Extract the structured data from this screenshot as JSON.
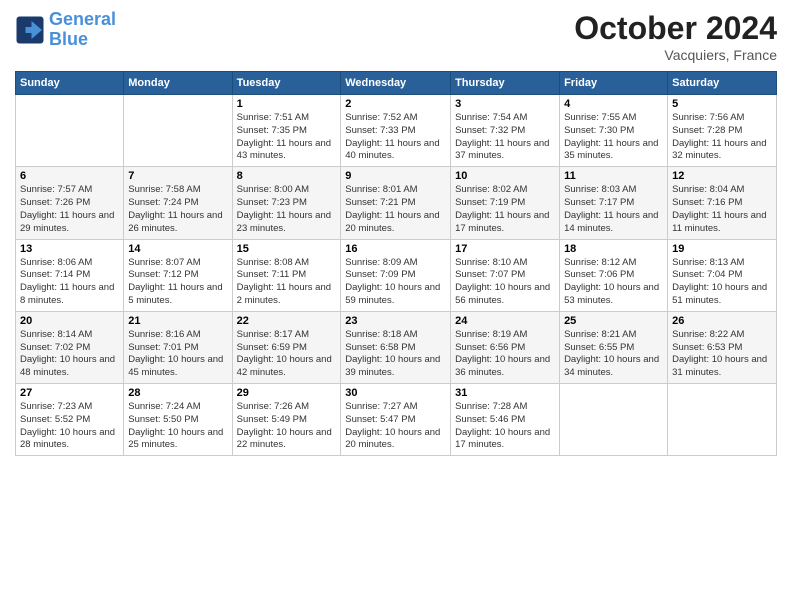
{
  "header": {
    "logo_line1": "General",
    "logo_line2": "Blue",
    "month": "October 2024",
    "location": "Vacquiers, France"
  },
  "weekdays": [
    "Sunday",
    "Monday",
    "Tuesday",
    "Wednesday",
    "Thursday",
    "Friday",
    "Saturday"
  ],
  "weeks": [
    [
      {
        "day": "",
        "info": ""
      },
      {
        "day": "",
        "info": ""
      },
      {
        "day": "1",
        "info": "Sunrise: 7:51 AM\nSunset: 7:35 PM\nDaylight: 11 hours and 43 minutes."
      },
      {
        "day": "2",
        "info": "Sunrise: 7:52 AM\nSunset: 7:33 PM\nDaylight: 11 hours and 40 minutes."
      },
      {
        "day": "3",
        "info": "Sunrise: 7:54 AM\nSunset: 7:32 PM\nDaylight: 11 hours and 37 minutes."
      },
      {
        "day": "4",
        "info": "Sunrise: 7:55 AM\nSunset: 7:30 PM\nDaylight: 11 hours and 35 minutes."
      },
      {
        "day": "5",
        "info": "Sunrise: 7:56 AM\nSunset: 7:28 PM\nDaylight: 11 hours and 32 minutes."
      }
    ],
    [
      {
        "day": "6",
        "info": "Sunrise: 7:57 AM\nSunset: 7:26 PM\nDaylight: 11 hours and 29 minutes."
      },
      {
        "day": "7",
        "info": "Sunrise: 7:58 AM\nSunset: 7:24 PM\nDaylight: 11 hours and 26 minutes."
      },
      {
        "day": "8",
        "info": "Sunrise: 8:00 AM\nSunset: 7:23 PM\nDaylight: 11 hours and 23 minutes."
      },
      {
        "day": "9",
        "info": "Sunrise: 8:01 AM\nSunset: 7:21 PM\nDaylight: 11 hours and 20 minutes."
      },
      {
        "day": "10",
        "info": "Sunrise: 8:02 AM\nSunset: 7:19 PM\nDaylight: 11 hours and 17 minutes."
      },
      {
        "day": "11",
        "info": "Sunrise: 8:03 AM\nSunset: 7:17 PM\nDaylight: 11 hours and 14 minutes."
      },
      {
        "day": "12",
        "info": "Sunrise: 8:04 AM\nSunset: 7:16 PM\nDaylight: 11 hours and 11 minutes."
      }
    ],
    [
      {
        "day": "13",
        "info": "Sunrise: 8:06 AM\nSunset: 7:14 PM\nDaylight: 11 hours and 8 minutes."
      },
      {
        "day": "14",
        "info": "Sunrise: 8:07 AM\nSunset: 7:12 PM\nDaylight: 11 hours and 5 minutes."
      },
      {
        "day": "15",
        "info": "Sunrise: 8:08 AM\nSunset: 7:11 PM\nDaylight: 11 hours and 2 minutes."
      },
      {
        "day": "16",
        "info": "Sunrise: 8:09 AM\nSunset: 7:09 PM\nDaylight: 10 hours and 59 minutes."
      },
      {
        "day": "17",
        "info": "Sunrise: 8:10 AM\nSunset: 7:07 PM\nDaylight: 10 hours and 56 minutes."
      },
      {
        "day": "18",
        "info": "Sunrise: 8:12 AM\nSunset: 7:06 PM\nDaylight: 10 hours and 53 minutes."
      },
      {
        "day": "19",
        "info": "Sunrise: 8:13 AM\nSunset: 7:04 PM\nDaylight: 10 hours and 51 minutes."
      }
    ],
    [
      {
        "day": "20",
        "info": "Sunrise: 8:14 AM\nSunset: 7:02 PM\nDaylight: 10 hours and 48 minutes."
      },
      {
        "day": "21",
        "info": "Sunrise: 8:16 AM\nSunset: 7:01 PM\nDaylight: 10 hours and 45 minutes."
      },
      {
        "day": "22",
        "info": "Sunrise: 8:17 AM\nSunset: 6:59 PM\nDaylight: 10 hours and 42 minutes."
      },
      {
        "day": "23",
        "info": "Sunrise: 8:18 AM\nSunset: 6:58 PM\nDaylight: 10 hours and 39 minutes."
      },
      {
        "day": "24",
        "info": "Sunrise: 8:19 AM\nSunset: 6:56 PM\nDaylight: 10 hours and 36 minutes."
      },
      {
        "day": "25",
        "info": "Sunrise: 8:21 AM\nSunset: 6:55 PM\nDaylight: 10 hours and 34 minutes."
      },
      {
        "day": "26",
        "info": "Sunrise: 8:22 AM\nSunset: 6:53 PM\nDaylight: 10 hours and 31 minutes."
      }
    ],
    [
      {
        "day": "27",
        "info": "Sunrise: 7:23 AM\nSunset: 5:52 PM\nDaylight: 10 hours and 28 minutes."
      },
      {
        "day": "28",
        "info": "Sunrise: 7:24 AM\nSunset: 5:50 PM\nDaylight: 10 hours and 25 minutes."
      },
      {
        "day": "29",
        "info": "Sunrise: 7:26 AM\nSunset: 5:49 PM\nDaylight: 10 hours and 22 minutes."
      },
      {
        "day": "30",
        "info": "Sunrise: 7:27 AM\nSunset: 5:47 PM\nDaylight: 10 hours and 20 minutes."
      },
      {
        "day": "31",
        "info": "Sunrise: 7:28 AM\nSunset: 5:46 PM\nDaylight: 10 hours and 17 minutes."
      },
      {
        "day": "",
        "info": ""
      },
      {
        "day": "",
        "info": ""
      }
    ]
  ]
}
